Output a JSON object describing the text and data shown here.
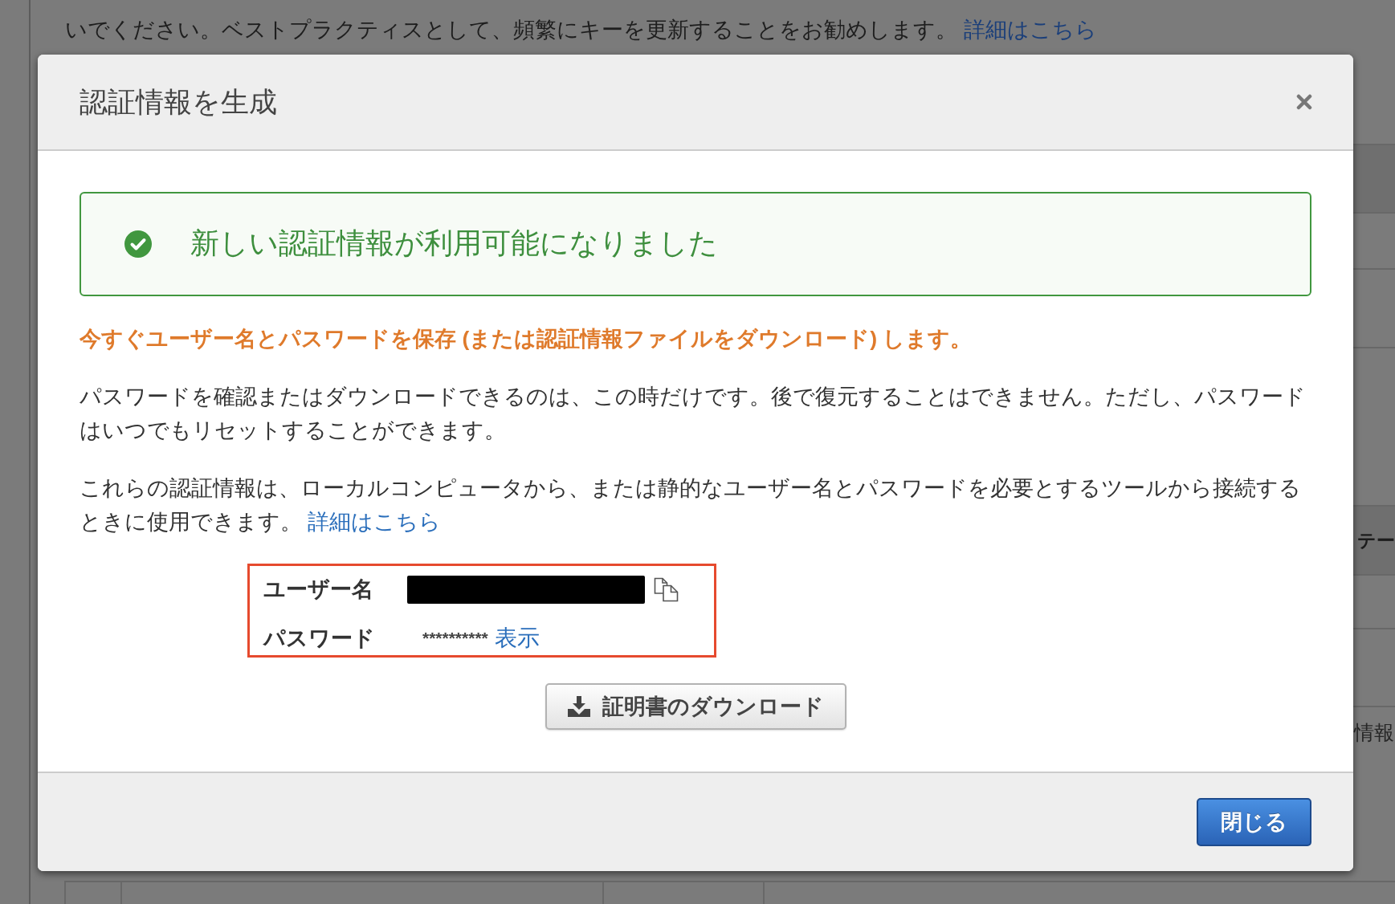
{
  "background_page": {
    "notice": {
      "text": "いでください。ベストプラクティスとして、頻繁にキーを更新することをお勧めします。",
      "link": "詳細はこちら"
    },
    "side_cells": [
      {
        "kind": "header",
        "text": "テー"
      },
      {
        "kind": "cell",
        "text": "情報"
      }
    ]
  },
  "dialog": {
    "title": "認証情報を生成",
    "success_alert": {
      "message": "新しい認証情報が利用可能になりました"
    },
    "warning": "今すぐユーザー名とパスワードを保存 (または認証情報ファイルをダウンロード) します。",
    "paragraphs": [
      {
        "text": "パスワードを確認またはダウンロードできるのは、この時だけです。後で復元することはできません。ただし、パスワードはいつでもリセットすることができます。"
      },
      {
        "text": "これらの認証情報は、ローカルコンピュータから、または静的なユーザー名とパスワードを必要とするツールから接続するときに使用できます。",
        "link": "詳細はこちら"
      }
    ],
    "credentials": [
      {
        "kind": "redacted",
        "label": "ユーザー名"
      },
      {
        "kind": "masked",
        "label": "パスワード",
        "value": "**********",
        "action": "表示"
      }
    ],
    "download_button": "証明書のダウンロード",
    "close_button": "閉じる"
  }
}
